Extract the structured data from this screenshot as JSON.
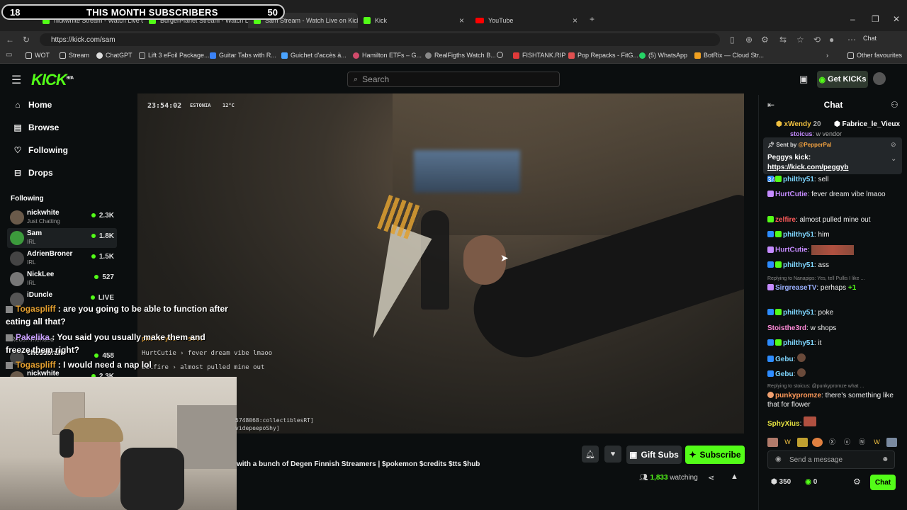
{
  "overlay": {
    "left_count": "18",
    "title": "THIS MONTH SUBSCRIBERS",
    "right_count": "50"
  },
  "tabs": [
    {
      "label": "nickwhite Stream - Watch Live on Kick"
    },
    {
      "label": "BurgerPlanet Stream - Watch Live on Kick"
    },
    {
      "label": "Sam Stream - Watch Live on Kick"
    },
    {
      "label": "Kick"
    },
    {
      "label": "YouTube"
    }
  ],
  "url": "https://kick.com/sam",
  "browser": {
    "profile_label": "Chat"
  },
  "bookmarks": [
    "WOT",
    "Stream",
    "ChatGPT",
    "Lift 3 eFoil Package...",
    "Guitar Tabs with R...",
    "Guichet d'accès à...",
    "Hamilton ETFs – G...",
    "RealFigths Watch B...",
    "FISHTANK.RIP",
    "Pop Repacks - FitG...",
    "(5) WhatsApp",
    "BotRix — Cloud Str...",
    "Other favourites"
  ],
  "header": {
    "logo": "KICK",
    "logo_beta": "BETA",
    "search_placeholder": "Search",
    "get_kicks": "Get KICKs"
  },
  "sidebar": {
    "nav": [
      {
        "label": "Home",
        "icon": "home-icon"
      },
      {
        "label": "Browse",
        "icon": "browse-icon"
      },
      {
        "label": "Following",
        "icon": "heart-icon"
      },
      {
        "label": "Drops",
        "icon": "drops-icon"
      }
    ],
    "following_title": "Following",
    "following": [
      {
        "name": "nickwhite",
        "category": "Just Chatting",
        "viewers": "2.3K"
      },
      {
        "name": "Sam",
        "category": "IRL",
        "viewers": "1.8K"
      },
      {
        "name": "AdrienBroner",
        "category": "IRL",
        "viewers": "1.5K"
      },
      {
        "name": "NickLee",
        "category": "IRL",
        "viewers": "527"
      },
      {
        "name": "iDuncle",
        "category": "",
        "viewers": "LIVE"
      }
    ],
    "recommended_title": "Recommended",
    "recommended": [
      {
        "name": "chessbrah",
        "viewers": "458"
      },
      {
        "name": "nickwhite",
        "viewers": "2.3K"
      }
    ]
  },
  "video": {
    "time": "23:54:02",
    "location": "ESTONIA",
    "temperature": "12°C",
    "overlay_lines": [
      "philthy51 : sell",
      "HurtCutie › fever dream vibe lmaoo",
      "zelfire › almost pulled mine out",
      "5748068:collectiblesRT]",
      "videpeepoShy]"
    ]
  },
  "stream_chat_overlay": [
    {
      "user": "Togaspliff",
      "text": ": are you going to be able to function after eating all that?"
    },
    {
      "user": "Pakelika",
      "text": ": You said you usually make them and freeze them right?"
    },
    {
      "user": "Togaspliff",
      "text": ": I would need a nap lol"
    }
  ],
  "stream": {
    "title": "with a bunch of Degen Finnish Streamers | $pokemon $credits $tts $hub",
    "gift_subs": "Gift Subs",
    "subscribe": "Subscribe",
    "watching_count": "1,833",
    "watching_label": "watching"
  },
  "chat": {
    "title": "Chat",
    "top_gifters": [
      {
        "name": "xWendy",
        "count": "20"
      },
      {
        "name": "Fabrice_le_Vieux",
        "count": ""
      }
    ],
    "peek": {
      "user": "stoicus",
      "text": "w vendor"
    },
    "pinned": {
      "sent_by": "Sent by",
      "sender": "@PepperPal",
      "text": "Peggys kick:",
      "link": "https://kick.com/peggyb"
    },
    "messages": [
      {
        "badge": "34",
        "user": "philthy51",
        "color": "#7fd6ff",
        "text": ": sell"
      },
      {
        "badge": "",
        "user": "HurtCutie",
        "color": "#c58bff",
        "text": ": fever dream vibe lmaoo"
      },
      {
        "badge": "43",
        "user": "zelfire",
        "color": "#ff5a5a",
        "text": ": almost pulled mine out"
      },
      {
        "badge": "34",
        "user": "philthy51",
        "color": "#7fd6ff",
        "text": ": him"
      },
      {
        "badge": "26",
        "user": "HurtCutie",
        "color": "#c58bff",
        "text": ":"
      },
      {
        "badge": "34",
        "user": "philthy51",
        "color": "#7fd6ff",
        "text": ": ass"
      },
      {
        "badge": "",
        "user": "SirgreaseTV",
        "color": "#9ab0ff",
        "text": ": perhaps"
      },
      {
        "badge": "34",
        "user": "philthy51",
        "color": "#7fd6ff",
        "text": ": poke"
      },
      {
        "badge": "",
        "user": "Stoisthe3rd",
        "color": "#ff8ad8",
        "text": ": w shops"
      },
      {
        "badge": "34",
        "user": "philthy51",
        "color": "#7fd6ff",
        "text": ": it"
      },
      {
        "badge": "37",
        "user": "Gebu",
        "color": "#7fd6ff",
        "text": ":"
      },
      {
        "badge": "37",
        "user": "Gebu",
        "color": "#7fd6ff",
        "text": ":"
      },
      {
        "badge": "",
        "user": "punkypromze",
        "color": "#ff9a5a",
        "text": ": there's something like that for flower"
      },
      {
        "badge": "",
        "user": "SphyXius",
        "color": "#e4e040",
        "text": ":"
      }
    ],
    "replies": [
      {
        "text": "Replying to Nanapips: Yes, tell Pullis I like ..."
      },
      {
        "text": "Replying to stoicus: @punkypromze what ..."
      }
    ],
    "emote_plus": "+1",
    "send_placeholder": "Send a message",
    "kicks": "350",
    "points": "0",
    "chat_button": "Chat"
  },
  "colors": {
    "accent": "#53fc18"
  }
}
